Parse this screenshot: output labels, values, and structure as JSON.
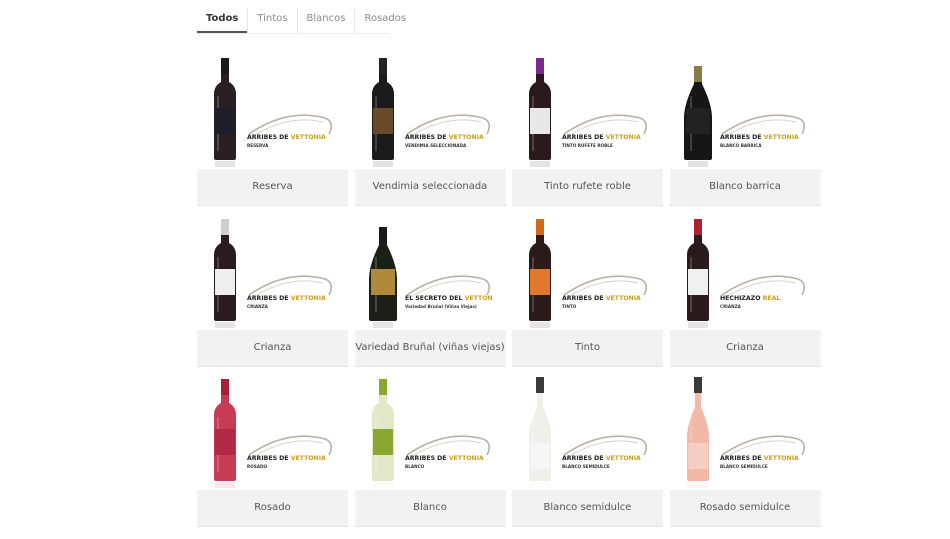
{
  "filters": [
    {
      "label": "Todos",
      "active": true
    },
    {
      "label": "Tintos",
      "active": false
    },
    {
      "label": "Blancos",
      "active": false
    },
    {
      "label": "Rosados",
      "active": false
    }
  ],
  "products": [
    {
      "name": "Reserva",
      "brand": "ARRIBES DE",
      "brand_accent": "VETTONIA",
      "variant": "RESERVA",
      "bottle": "#2a1f22",
      "label": "#1e1e2a",
      "cap": "#1a1a1a",
      "shape": "bordeaux"
    },
    {
      "name": "Vendimia seleccionada",
      "brand": "ARRIBES DE",
      "brand_accent": "VETTONIA",
      "variant": "VENDIMIA SELECCIONADA",
      "bottle": "#1c1a1a",
      "label": "#6a4a2a",
      "cap": "#222222",
      "shape": "bordeaux"
    },
    {
      "name": "Tinto rufete roble",
      "brand": "ARRIBES DE",
      "brand_accent": "VETTONIA",
      "variant": "TINTO RUFETE ROBLE",
      "bottle": "#2a1a1e",
      "label": "#e8e8ea",
      "cap": "#7a2a8a",
      "shape": "bordeaux"
    },
    {
      "name": "Blanco barrica",
      "brand": "ARRIBES DE",
      "brand_accent": "VETTONIA",
      "variant": "BLANCO BARRICA",
      "bottle": "#161616",
      "label": "#222222",
      "cap": "#8a7a4a",
      "shape": "burgundy"
    },
    {
      "name": "Crianza",
      "brand": "ARRIBES DE",
      "brand_accent": "VETTONIA",
      "variant": "CRIANZA",
      "bottle": "#2a1c1e",
      "label": "#eeeeee",
      "cap": "#cfcfcf",
      "shape": "bordeaux"
    },
    {
      "name": "Variedad Bruñal (viñas viejas)",
      "brand": "EL SECRETO DEL",
      "brand_accent": "VETTON",
      "variant": "Variedad Bruñal (Viñas Viejas)",
      "bottle": "#1a2018",
      "label": "#b08a3a",
      "cap": "#1a1a1a",
      "shape": "burgundy"
    },
    {
      "name": "Tinto",
      "brand": "ARRIBES DE",
      "brand_accent": "VETTONIA",
      "variant": "TINTO",
      "bottle": "#2a1a1a",
      "label": "#e07a2a",
      "cap": "#d06a1a",
      "shape": "bordeaux"
    },
    {
      "name": "Crianza",
      "brand": "HECHIZAZO",
      "brand_accent": "REAL",
      "variant": "CRIANZA",
      "bottle": "#2a1a1e",
      "label": "#f0f0f0",
      "cap": "#b02030",
      "shape": "bordeaux"
    },
    {
      "name": "Rosado",
      "brand": "ARRIBES DE",
      "brand_accent": "VETTONIA",
      "variant": "ROSADO",
      "bottle": "#c83a55",
      "label": "#b02a45",
      "cap": "#a82035",
      "shape": "bordeaux"
    },
    {
      "name": "Blanco",
      "brand": "ARRIBES DE",
      "brand_accent": "VETTONIA",
      "variant": "BLANCO",
      "bottle": "#e2e8c8",
      "label": "#8aa830",
      "cap": "#8aa830",
      "shape": "bordeaux"
    },
    {
      "name": "Blanco semidulce",
      "brand": "ARRIBES DE",
      "brand_accent": "VETTONIA",
      "variant": "BLANCO SEMIDULCE",
      "bottle": "#eef0ea",
      "label": "#f6f6f6",
      "cap": "#3a3a3a",
      "shape": "rhine"
    },
    {
      "name": "Rosado semidulce",
      "brand": "ARRIBES DE",
      "brand_accent": "VETTONIA",
      "variant": "BLANCO SEMIDULCE",
      "bottle": "#f2b8a8",
      "label": "#f6cfc2",
      "cap": "#3a3a3a",
      "shape": "rhine"
    }
  ]
}
